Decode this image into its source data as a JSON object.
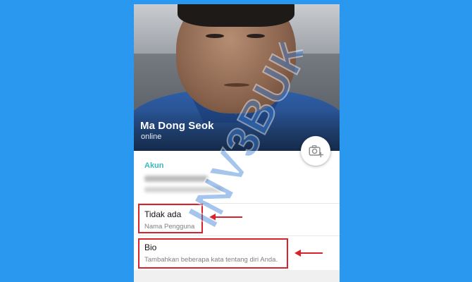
{
  "profile": {
    "name": "Ma Dong Seok",
    "status": "online"
  },
  "account": {
    "section_title": "Akun",
    "username_value": "Tidak ada",
    "username_label": "Nama Pengguna",
    "bio_value": "Bio",
    "bio_label": "Tambahkan beberapa kata tentang diri Anda."
  },
  "watermark_text": "INV3BUKU",
  "colors": {
    "background": "#2b98f0",
    "accent": "#3cb7b8",
    "highlight": "#d8232a"
  },
  "icons": {
    "camera": "add-photo-camera-icon",
    "arrows": "left-arrow-icon"
  }
}
